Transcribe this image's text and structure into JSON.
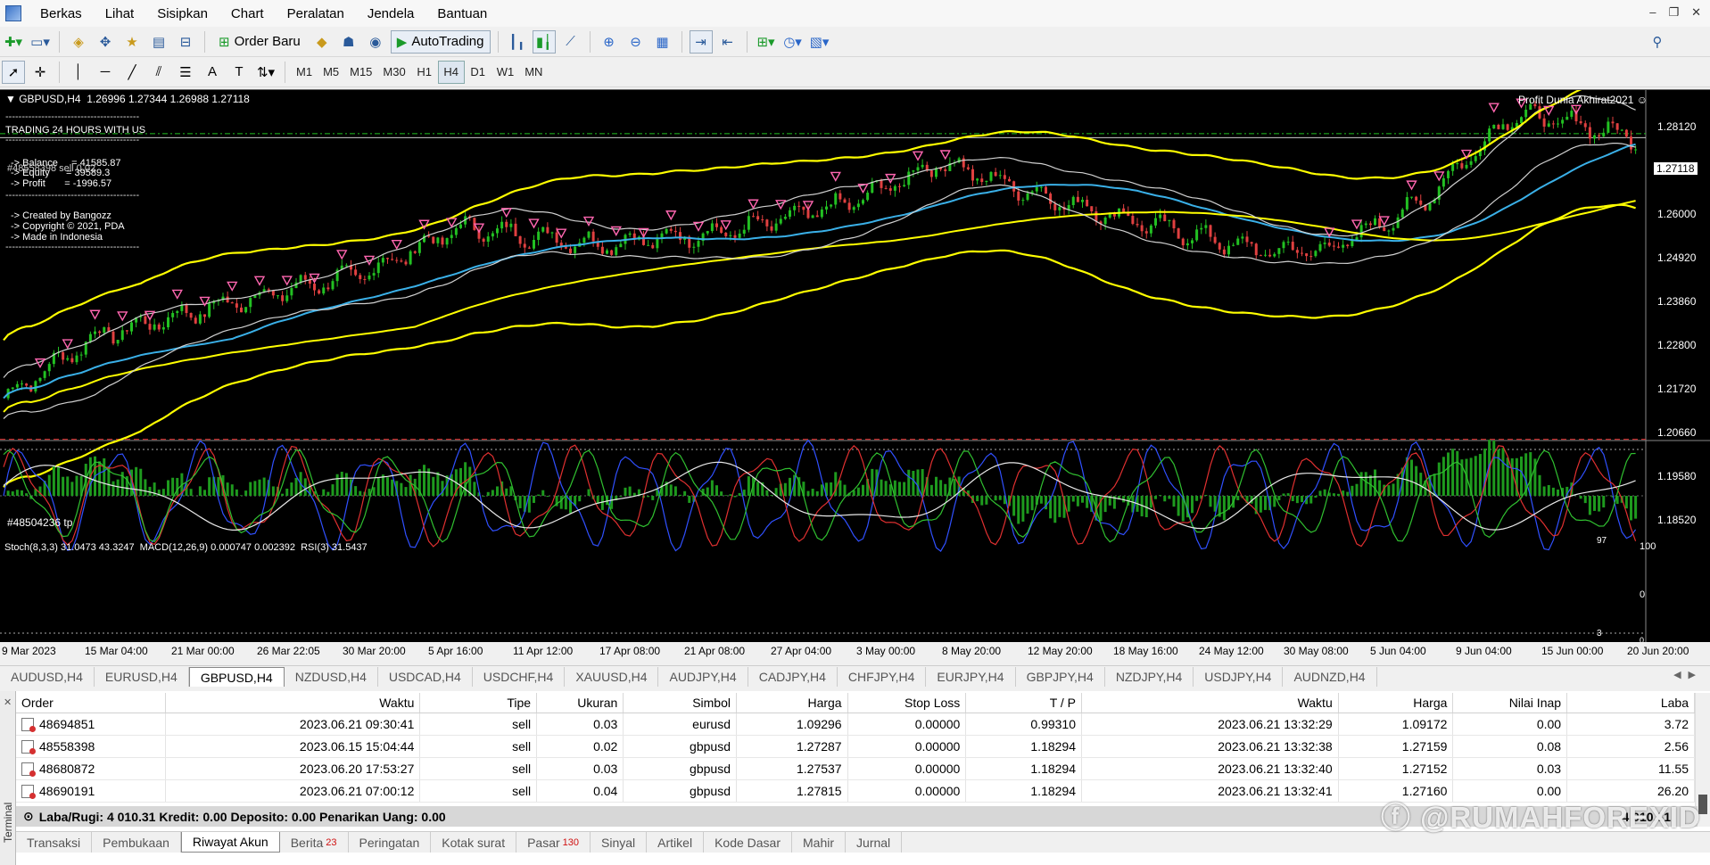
{
  "menu": [
    "Berkas",
    "Lihat",
    "Sisipkan",
    "Chart",
    "Peralatan",
    "Jendela",
    "Bantuan"
  ],
  "toolbar": {
    "order_button": "Order Baru",
    "autotrading_button": "AutoTrading",
    "timeframes": [
      "M1",
      "M5",
      "M15",
      "M30",
      "H1",
      "H4",
      "D1",
      "W1",
      "MN"
    ],
    "active_timeframe": "H4",
    "notification_count": "1"
  },
  "chart": {
    "header": "GBPUSD,H4  1.26996 1.27344 1.26988 1.27118",
    "indicator_title": "Profit Dunia Akhirat2021",
    "info_lines": {
      "l1": "TRADING 24 HOURS WITH US",
      "l2": "-> Balance     = 41585.87",
      "l3": "-> Equity      = 39589.3",
      "l4": "-> Profit       = -1996.57",
      "l5": "-> Created by Bangozz",
      "l6": "-> Copyright © 2021, PDA",
      "l7": "-> Made in Indonesia"
    },
    "overlay_order_label": "#48558398 sell 0.02",
    "tp_label": "#48504236 tp",
    "current_price": "1.27118",
    "price_axis": [
      "1.28120",
      "1.27118",
      "1.26000",
      "1.24920",
      "1.23860",
      "1.22800",
      "1.21720",
      "1.20660",
      "1.19580",
      "1.18520"
    ],
    "subwindow_header": "Stoch(8,3,3) 31.0473 43.3247  MACD(12,26,9) 0.000747 0.002392  RSI(3) 31.5437",
    "subwindow_axis": [
      "100",
      "0",
      "0",
      "97",
      "3"
    ],
    "date_axis": [
      "9 Mar 2023",
      "15 Mar 04:00",
      "21 Mar 00:00",
      "26 Mar 22:05",
      "30 Mar 20:00",
      "5 Apr 16:00",
      "11 Apr 12:00",
      "17 Apr 08:00",
      "21 Apr 08:00",
      "27 Apr 04:00",
      "3 May 00:00",
      "8 May 20:00",
      "12 May 20:00",
      "18 May 16:00",
      "24 May 12:00",
      "30 May 08:00",
      "5 Jun 04:00",
      "9 Jun 04:00",
      "15 Jun 00:00",
      "20 Jun 20:00"
    ],
    "colors": {
      "bull": "#22c022",
      "bear": "#e04040",
      "band_yellow": "#ffff00",
      "ma_blue": "#3ab0e8",
      "ma_white": "#d0d0d0",
      "arrow_pink": "#ff66b0"
    }
  },
  "symbol_tabs": [
    "AUDUSD,H4",
    "EURUSD,H4",
    "GBPUSD,H4",
    "NZDUSD,H4",
    "USDCAD,H4",
    "USDCHF,H4",
    "XAUUSD,H4",
    "AUDJPY,H4",
    "CADJPY,H4",
    "CHFJPY,H4",
    "EURJPY,H4",
    "GBPJPY,H4",
    "NZDJPY,H4",
    "USDJPY,H4",
    "AUDNZD,H4"
  ],
  "active_symbol_tab": "GBPUSD,H4",
  "terminal": {
    "side_label": "Terminal",
    "columns": [
      "Order",
      "Waktu",
      "Tipe",
      "Ukuran",
      "Simbol",
      "Harga",
      "Stop Loss",
      "T / P",
      "Waktu",
      "Harga",
      "Nilai Inap",
      "Laba"
    ],
    "rows": [
      [
        "48694851",
        "2023.06.21 09:30:41",
        "sell",
        "0.03",
        "eurusd",
        "1.09296",
        "0.00000",
        "0.99310",
        "2023.06.21 13:32:29",
        "1.09172",
        "0.00",
        "3.72"
      ],
      [
        "48558398",
        "2023.06.15 15:04:44",
        "sell",
        "0.02",
        "gbpusd",
        "1.27287",
        "0.00000",
        "1.18294",
        "2023.06.21 13:32:38",
        "1.27159",
        "0.08",
        "2.56"
      ],
      [
        "48680872",
        "2023.06.20 17:53:27",
        "sell",
        "0.03",
        "gbpusd",
        "1.27537",
        "0.00000",
        "1.18294",
        "2023.06.21 13:32:40",
        "1.27152",
        "0.03",
        "11.55"
      ],
      [
        "48690191",
        "2023.06.21 07:00:12",
        "sell",
        "0.04",
        "gbpusd",
        "1.27815",
        "0.00000",
        "1.18294",
        "2023.06.21 13:32:41",
        "1.27160",
        "0.00",
        "26.20"
      ]
    ],
    "summary": "Laba/Rugi: 4 010.31  Kredit: 0.00  Deposito: 0.00  Penarikan Uang: 0.00",
    "summary_total": "4 010.31",
    "tabs": [
      {
        "label": "Transaksi",
        "count": ""
      },
      {
        "label": "Pembukaan",
        "count": ""
      },
      {
        "label": "Riwayat Akun",
        "count": ""
      },
      {
        "label": "Berita",
        "count": "23"
      },
      {
        "label": "Peringatan",
        "count": ""
      },
      {
        "label": "Kotak surat",
        "count": ""
      },
      {
        "label": "Pasar",
        "count": "130"
      },
      {
        "label": "Sinyal",
        "count": ""
      },
      {
        "label": "Artikel",
        "count": ""
      },
      {
        "label": "Kode Dasar",
        "count": ""
      },
      {
        "label": "Mahir",
        "count": ""
      },
      {
        "label": "Jurnal",
        "count": ""
      }
    ],
    "active_tab": "Riwayat Akun"
  },
  "watermark": "@RUMAHFOREXID"
}
